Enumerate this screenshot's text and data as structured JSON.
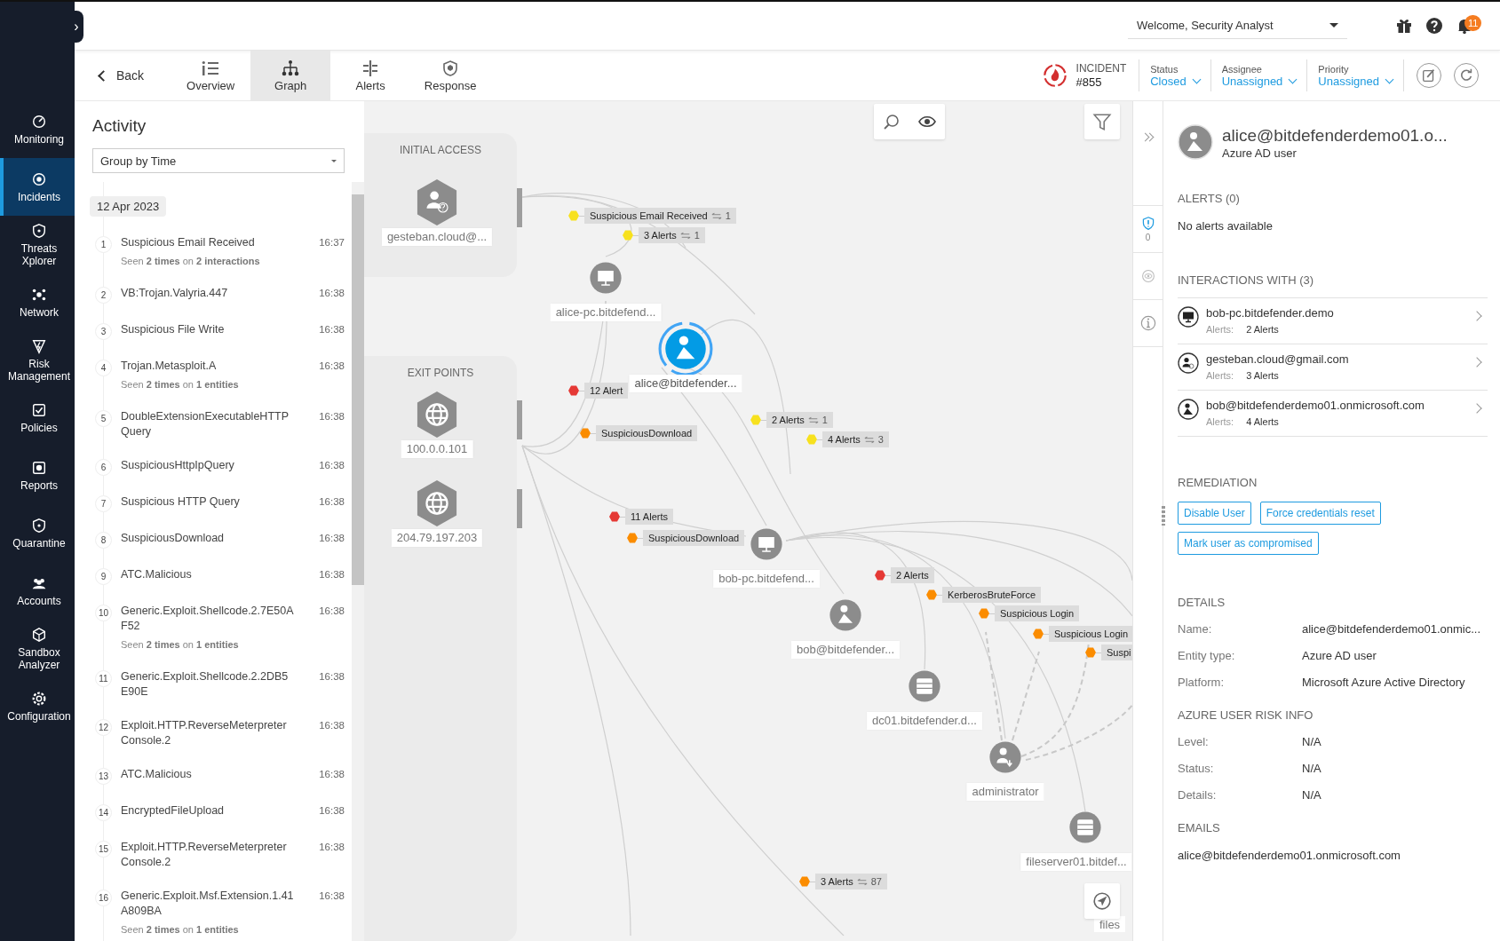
{
  "sidebar": {
    "items": [
      {
        "label": "Monitoring",
        "selected": false
      },
      {
        "label": "Incidents",
        "selected": true
      },
      {
        "label": "Threats Xplorer",
        "selected": false
      },
      {
        "label": "Network",
        "selected": false
      },
      {
        "label": "Risk Management",
        "selected": false
      },
      {
        "label": "Policies",
        "selected": false
      },
      {
        "label": "Reports",
        "selected": false
      },
      {
        "label": "Quarantine",
        "selected": false
      },
      {
        "label": "Accounts",
        "selected": false
      },
      {
        "label": "Sandbox Analyzer",
        "selected": false
      },
      {
        "label": "Configuration",
        "selected": false
      }
    ],
    "expand_glyph": "›"
  },
  "header": {
    "welcome": "Welcome, Security Analyst",
    "notification_count": "11"
  },
  "tabs": {
    "back": "Back",
    "items": [
      {
        "label": "Overview",
        "selected": false
      },
      {
        "label": "Graph",
        "selected": true
      },
      {
        "label": "Alerts",
        "selected": false
      },
      {
        "label": "Response",
        "selected": false
      }
    ]
  },
  "incident": {
    "label": "INCIDENT",
    "number": "#855",
    "fields": [
      {
        "label": "Status",
        "value": "Closed"
      },
      {
        "label": "Assignee",
        "value": "Unassigned"
      },
      {
        "label": "Priority",
        "value": "Unassigned"
      }
    ]
  },
  "activity": {
    "title": "Activity",
    "group_by": "Group by Time",
    "date": "12 Apr 2023",
    "events": [
      {
        "number": "1",
        "title": "Suspicious Email Received",
        "time": "16:37",
        "seen": "Seen **2 times** on **2 interactions**"
      },
      {
        "number": "2",
        "title": "VB:Trojan.Valyria.447",
        "time": "16:38"
      },
      {
        "number": "3",
        "title": "Suspicious File Write",
        "time": "16:38"
      },
      {
        "number": "4",
        "title": "Trojan.Metasploit.A",
        "time": "16:38",
        "seen": "Seen **2 times** on **1 entities**"
      },
      {
        "number": "5",
        "title": "DoubleExtensionExecutableHTTP Query",
        "time": "16:38"
      },
      {
        "number": "6",
        "title": "SuspiciousHttpIpQuery",
        "time": "16:38"
      },
      {
        "number": "7",
        "title": "Suspicious HTTP Query",
        "time": "16:38"
      },
      {
        "number": "8",
        "title": "SuspiciousDownload",
        "time": "16:38"
      },
      {
        "number": "9",
        "title": "ATC.Malicious",
        "time": "16:38"
      },
      {
        "number": "10",
        "title": "Generic.Exploit.Shellcode.2.7E50A F52",
        "time": "16:38",
        "seen": "Seen **2 times** on **1 entities**"
      },
      {
        "number": "11",
        "title": "Generic.Exploit.Shellcode.2.2DB5 E90E",
        "time": "16:38"
      },
      {
        "number": "12",
        "title": "Exploit.HTTP.ReverseMeterpreter Console.2",
        "time": "16:38"
      },
      {
        "number": "13",
        "title": "ATC.Malicious",
        "time": "16:38"
      },
      {
        "number": "14",
        "title": "EncryptedFileUpload",
        "time": "16:38"
      },
      {
        "number": "15",
        "title": "Exploit.HTTP.ReverseMeterpreter Console.2",
        "time": "16:38"
      },
      {
        "number": "16",
        "title": "Generic.Exploit.Msf.Extension.1.41 A809BA",
        "time": "16:38",
        "seen": "Seen **2 times** on **1 entities**"
      }
    ]
  },
  "graph": {
    "groups": [
      {
        "title": "INITIAL ACCESS"
      },
      {
        "title": "EXIT POINTS"
      }
    ],
    "nodes": [
      {
        "kind": "unknown-user",
        "label": "gesteban.cloud@...",
        "selected": false
      },
      {
        "kind": "computer",
        "label": "alice-pc.bitdefend...",
        "selected": false
      },
      {
        "kind": "azure-user",
        "label": "alice@bitdefender...",
        "selected": true
      },
      {
        "kind": "ip",
        "label": "100.0.0.101",
        "selected": false
      },
      {
        "kind": "ip",
        "label": "204.79.197.203",
        "selected": false
      },
      {
        "kind": "computer",
        "label": "bob-pc.bitdefend...",
        "selected": false
      },
      {
        "kind": "azure-user",
        "label": "bob@bitdefender...",
        "selected": false
      },
      {
        "kind": "server",
        "label": "dc01.bitdefender.d...",
        "selected": false
      },
      {
        "kind": "admin",
        "label": "administrator",
        "selected": false
      },
      {
        "kind": "server",
        "label": "fileserver01.bitdef...",
        "selected": false
      }
    ],
    "cut_label": "files",
    "alerts": [
      {
        "label": "Suspicious Email Received",
        "count": "1",
        "color": "#f7e11e"
      },
      {
        "label": "3 Alerts",
        "count": "1",
        "color": "#f7e11e"
      },
      {
        "label": "12 Alert",
        "color": "#e53935"
      },
      {
        "label": "SuspiciousDownload",
        "color": "#fb8c00"
      },
      {
        "label": "2 Alerts",
        "count": "1",
        "color": "#f7e11e"
      },
      {
        "label": "4 Alerts",
        "count": "3",
        "color": "#f7e11e"
      },
      {
        "label": "11 Alerts",
        "color": "#e53935"
      },
      {
        "label": "SuspiciousDownload",
        "color": "#fb8c00"
      },
      {
        "label": "2 Alerts",
        "color": "#e53935"
      },
      {
        "label": "KerberosBruteForce",
        "color": "#fb8c00"
      },
      {
        "label": "Suspicious Login",
        "color": "#fb8c00"
      },
      {
        "label": "Suspicious Login",
        "color": "#fb8c00"
      },
      {
        "label": "Suspi",
        "color": "#fb8c00"
      },
      {
        "label": "3 Alerts",
        "count": "87",
        "color": "#fb8c00"
      }
    ]
  },
  "side_strip": {
    "alerts_count": "0"
  },
  "entity": {
    "name": "alice@bitdefenderdemo01.o...",
    "type": "Azure AD user",
    "alerts_title": "ALERTS (0)",
    "alerts_empty": "No alerts available",
    "interactions_title": "INTERACTIONS WITH (3)",
    "interactions": [
      {
        "kind": "computer",
        "name": "bob-pc.bitdefender.demo",
        "alerts_label": "Alerts:",
        "alerts": "2 Alerts"
      },
      {
        "kind": "unknown-user",
        "name": "gesteban.cloud@gmail.com",
        "alerts_label": "Alerts:",
        "alerts": "3 Alerts"
      },
      {
        "kind": "azure-user",
        "name": "bob@bitdefenderdemo01.onmicrosoft.com",
        "alerts_label": "Alerts:",
        "alerts": "4 Alerts"
      }
    ],
    "remediation_title": "REMEDIATION",
    "actions": [
      "Disable User",
      "Force credentials reset",
      "Mark user as compromised"
    ],
    "details_title": "DETAILS",
    "details": [
      {
        "label": "Name:",
        "value": "alice@bitdefenderdemo01.onmic..."
      },
      {
        "label": "Entity type:",
        "value": "Azure AD user"
      },
      {
        "label": "Platform:",
        "value": "Microsoft Azure Active Directory"
      }
    ],
    "risk_title": "AZURE USER RISK INFO",
    "risk": [
      {
        "label": "Level:",
        "value": "N/A"
      },
      {
        "label": "Status:",
        "value": "N/A"
      },
      {
        "label": "Details:",
        "value": "N/A"
      }
    ],
    "emails_title": "EMAILS",
    "emails": [
      "alice@bitdefenderdemo01.onmicrosoft.com"
    ]
  }
}
